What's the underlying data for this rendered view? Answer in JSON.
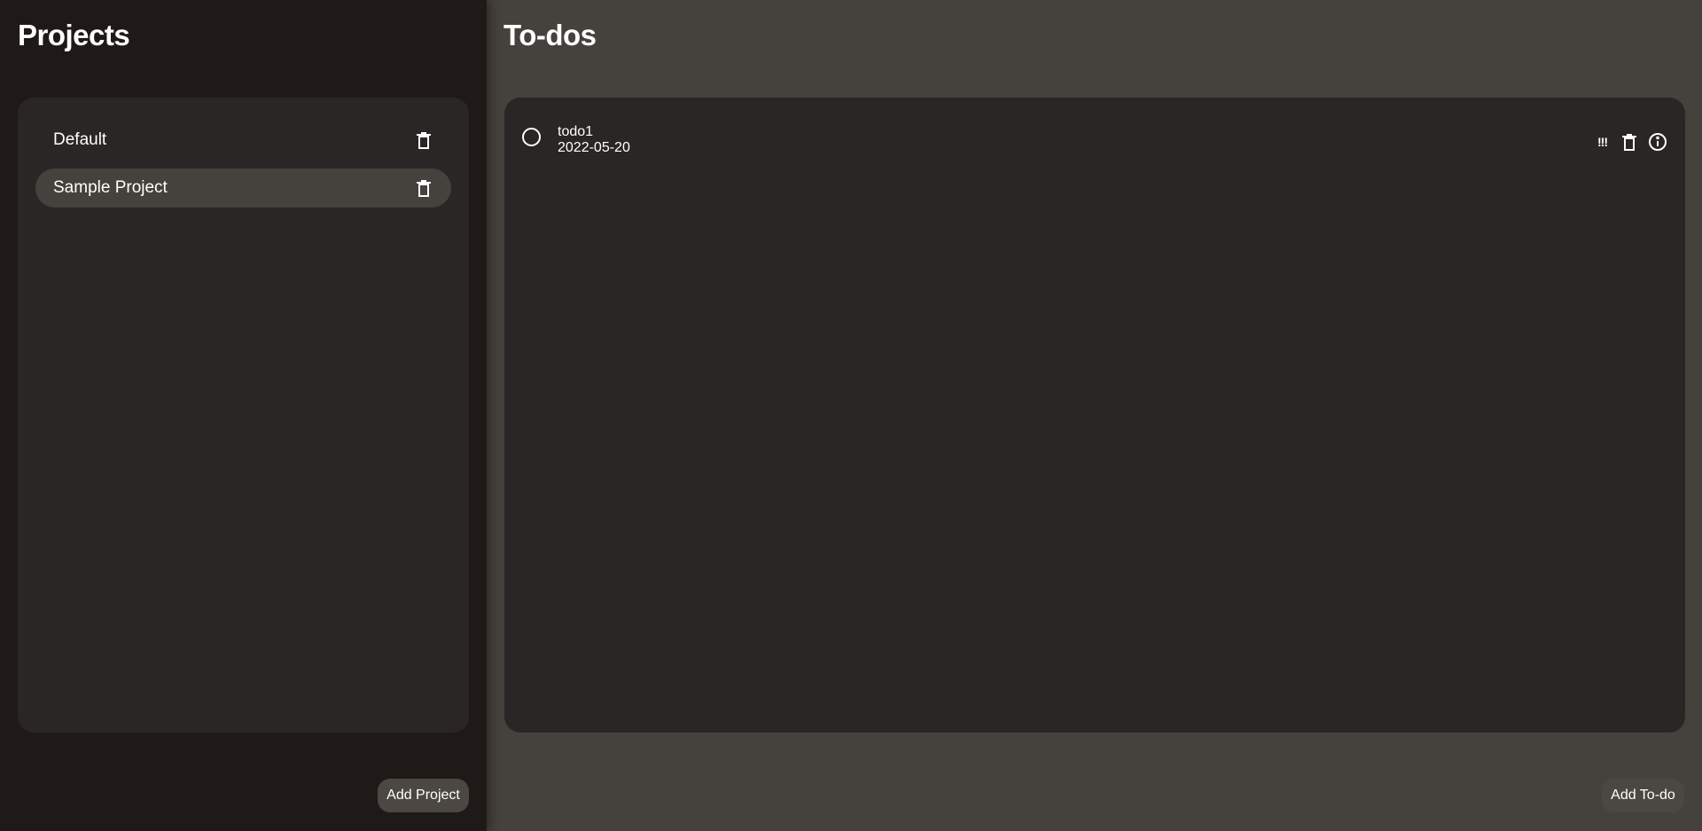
{
  "sidebar": {
    "title": "Projects",
    "projects": [
      {
        "label": "Default",
        "active": false
      },
      {
        "label": "Sample Project",
        "active": true
      }
    ],
    "add_button": "Add Project"
  },
  "main": {
    "title": "To-dos",
    "todos": [
      {
        "title": "todo1",
        "date": "2022-05-20",
        "priority": "!!!"
      }
    ],
    "add_button": "Add To-do"
  },
  "icons": {
    "delete": "trash-icon",
    "info": "info-icon",
    "complete": "circle-icon"
  },
  "colors": {
    "sidebar_bg": "#1f1a17",
    "main_bg": "#45413c",
    "panel_bg": "#292625",
    "active_item": "#45413c",
    "button_bg": "#4b4743"
  }
}
